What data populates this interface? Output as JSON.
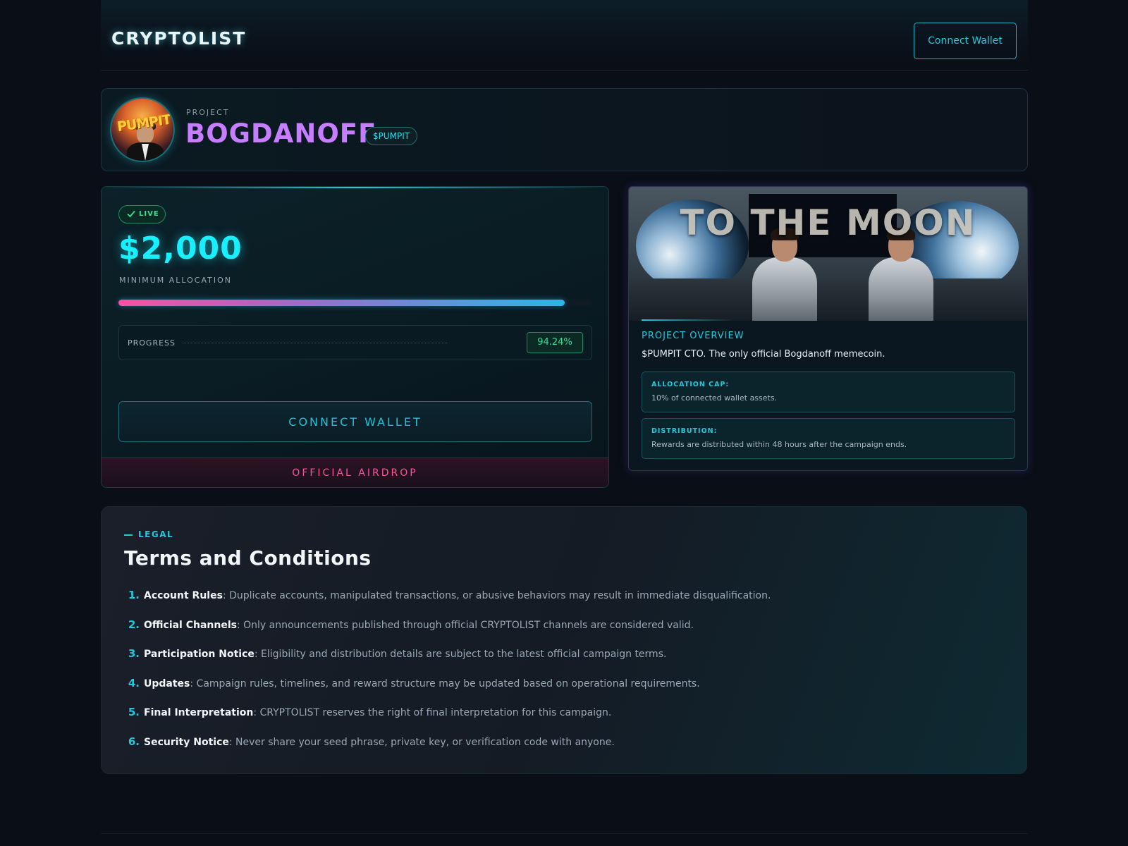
{
  "header": {
    "brand": "CRYPTOLIST",
    "connect_label": "Connect Wallet"
  },
  "project": {
    "label": "PROJECT",
    "name": "BOGDANOFF",
    "ticker": "$PUMPIT",
    "avatar_text": "PUMPIT"
  },
  "campaign": {
    "status": "LIVE",
    "amount": "$2,000",
    "amount_label": "MINIMUM ALLOCATION",
    "progress_label": "PROGRESS",
    "progress_value": "94.24%",
    "progress_fraction": 0.9424,
    "connect_label": "CONNECT WALLET",
    "footer_label": "OFFICIAL AIRDROP"
  },
  "overview": {
    "hero_text": "TO THE MOON",
    "heading": "PROJECT OVERVIEW",
    "description": "$PUMPIT CTO. The only official Bogdanoff memecoin.",
    "cap_label": "ALLOCATION CAP:",
    "cap_value": "10% of connected wallet assets.",
    "dist_label": "DISTRIBUTION:",
    "dist_value": "Rewards are distributed within 48 hours after the campaign ends."
  },
  "legal": {
    "tag": "LEGAL",
    "title": "Terms and Conditions",
    "terms": [
      {
        "n": "1.",
        "title": "Account Rules",
        "text": ": Duplicate accounts, manipulated transactions, or abusive behaviors may result in immediate disqualification."
      },
      {
        "n": "2.",
        "title": "Official Channels",
        "text": ": Only announcements published through official CRYPTOLIST channels are considered valid."
      },
      {
        "n": "3.",
        "title": "Participation Notice",
        "text": ": Eligibility and distribution details are subject to the latest official campaign terms."
      },
      {
        "n": "4.",
        "title": "Updates",
        "text": ": Campaign rules, timelines, and reward structure may be updated based on operational requirements."
      },
      {
        "n": "5.",
        "title": "Final Interpretation",
        "text": ": CRYPTOLIST reserves the right of final interpretation for this campaign."
      },
      {
        "n": "6.",
        "title": "Security Notice",
        "text": ": Never share your seed phrase, private key, or verification code with anyone."
      }
    ]
  },
  "colors": {
    "accent": "#22c8dc",
    "brand_purple": "#c77dff",
    "live_green": "#3ddc97",
    "airdrop_pink": "#ff4fa0",
    "background": "#0a0e16"
  },
  "icons": {
    "live": "check-icon"
  }
}
